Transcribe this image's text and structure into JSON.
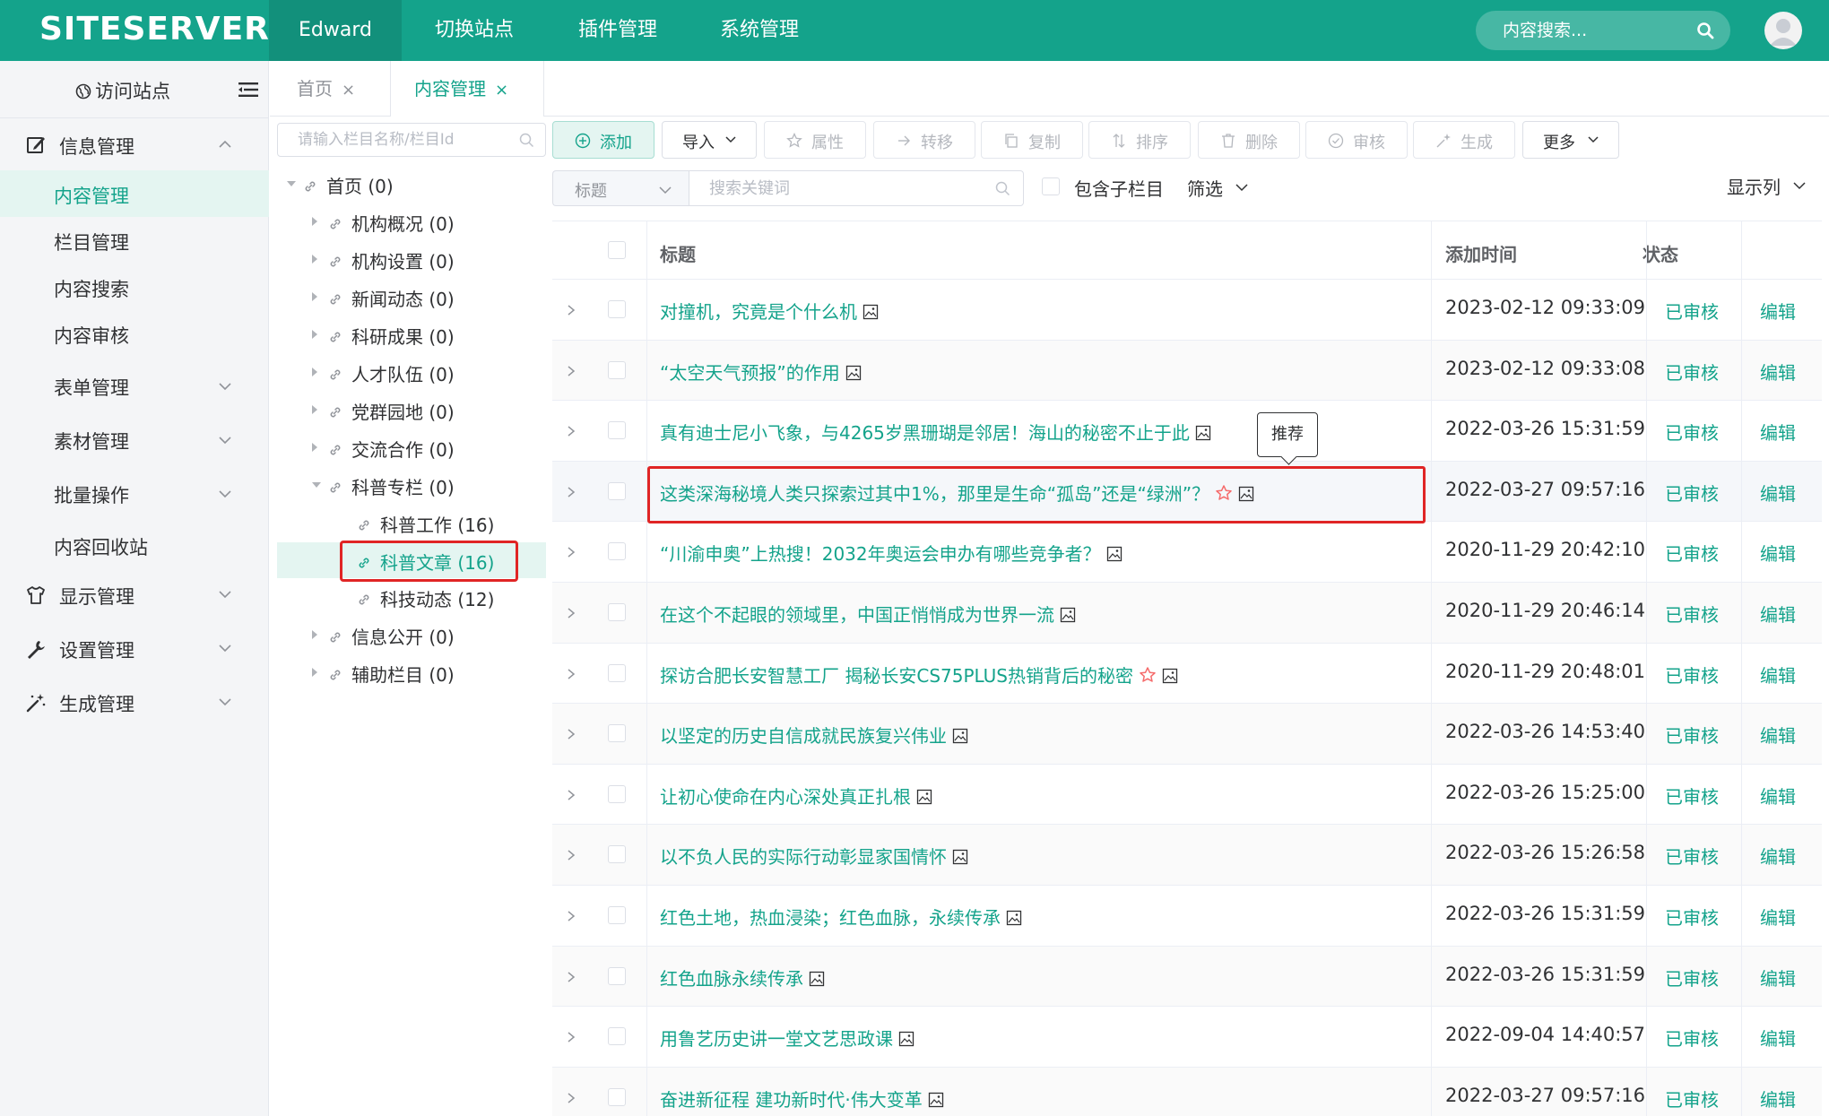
{
  "brand": {
    "logo": "SITESERVER"
  },
  "topnav": {
    "items": [
      "Edward",
      "切换站点",
      "插件管理",
      "系统管理"
    ],
    "search_placeholder": "内容搜索..."
  },
  "sidebar": {
    "visit_label": "访问站点",
    "groups": [
      {
        "label": "信息管理",
        "items": [
          {
            "label": "内容管理"
          },
          {
            "label": "栏目管理"
          },
          {
            "label": "内容搜索"
          },
          {
            "label": "内容审核"
          },
          {
            "label": "表单管理"
          },
          {
            "label": "素材管理"
          },
          {
            "label": "批量操作"
          },
          {
            "label": "内容回收站"
          }
        ]
      },
      {
        "label": "显示管理"
      },
      {
        "label": "设置管理"
      },
      {
        "label": "生成管理"
      }
    ]
  },
  "tabs": [
    {
      "label": "首页",
      "close": "×"
    },
    {
      "label": "内容管理",
      "close": "×"
    }
  ],
  "tree": {
    "search_placeholder": "请输入栏目名称/栏目Id",
    "nodes": [
      "首页 (0)",
      "机构概况 (0)",
      "机构设置 (0)",
      "新闻动态 (0)",
      "科研成果 (0)",
      "人才队伍 (0)",
      "党群园地 (0)",
      "交流合作 (0)",
      "科普专栏 (0)",
      "科普工作 (16)",
      "科普文章 (16)",
      "科技动态 (12)",
      "信息公开 (0)",
      "辅助栏目 (0)"
    ]
  },
  "toolbar": {
    "buttons": [
      "添加",
      "导入",
      "属性",
      "转移",
      "复制",
      "排序",
      "删除",
      "审核",
      "生成",
      "更多"
    ]
  },
  "filter": {
    "field_select": "标题",
    "keyword_placeholder": "搜索关键词",
    "include_children": "包含子栏目",
    "filter_label": "筛选",
    "columns_label": "显示列"
  },
  "table": {
    "headers": {
      "title": "标题",
      "time": "添加时间",
      "status": "状态"
    },
    "rows": [
      {
        "title": "对撞机，究竟是个什么机",
        "time": "2023-02-12 09:33:09",
        "status": "已审核",
        "action": "编辑"
      },
      {
        "title": "“太空天气预报”的作用",
        "time": "2023-02-12 09:33:08",
        "status": "已审核",
        "action": "编辑"
      },
      {
        "title": "真有迪士尼小飞象，与4265岁黑珊瑚是邻居！海山的秘密不止于此",
        "time": "2022-03-26 15:31:59",
        "status": "已审核",
        "action": "编辑"
      },
      {
        "title": "这类深海秘境人类只探索过其中1%，那里是生命“孤岛”还是“绿洲”？",
        "time": "2022-03-27 09:57:16",
        "status": "已审核",
        "action": "编辑"
      },
      {
        "title": "“川渝申奥”上热搜！2032年奥运会申办有哪些竞争者？",
        "time": "2020-11-29 20:42:10",
        "status": "已审核",
        "action": "编辑"
      },
      {
        "title": "在这个不起眼的领域里，中国正悄悄成为世界一流",
        "time": "2020-11-29 20:46:14",
        "status": "已审核",
        "action": "编辑"
      },
      {
        "title": "探访合肥长安智慧工厂 揭秘长安CS75PLUS热销背后的秘密",
        "time": "2020-11-29 20:48:01",
        "status": "已审核",
        "action": "编辑"
      },
      {
        "title": "以坚定的历史自信成就民族复兴伟业",
        "time": "2022-03-26 14:53:40",
        "status": "已审核",
        "action": "编辑"
      },
      {
        "title": "让初心使命在内心深处真正扎根",
        "time": "2022-03-26 15:25:00",
        "status": "已审核",
        "action": "编辑"
      },
      {
        "title": "以不负人民的实际行动彰显家国情怀",
        "time": "2022-03-26 15:26:58",
        "status": "已审核",
        "action": "编辑"
      },
      {
        "title": "红色土地，热血浸染；红色血脉，永续传承",
        "time": "2022-03-26 15:31:59",
        "status": "已审核",
        "action": "编辑"
      },
      {
        "title": "红色血脉永续传承",
        "time": "2022-03-26 15:31:59",
        "status": "已审核",
        "action": "编辑"
      },
      {
        "title": "用鲁艺历史讲一堂文艺思政课",
        "time": "2022-09-04 14:40:57",
        "status": "已审核",
        "action": "编辑"
      },
      {
        "title": "奋进新征程 建功新时代·伟大变革",
        "time": "2022-03-27 09:57:16",
        "status": "已审核",
        "action": "编辑"
      }
    ]
  },
  "tooltip": {
    "text": "推荐"
  },
  "colors": {
    "brand": "#14a38b",
    "highlight_box": "#e02525",
    "recommend_star": "#f56c6c"
  }
}
